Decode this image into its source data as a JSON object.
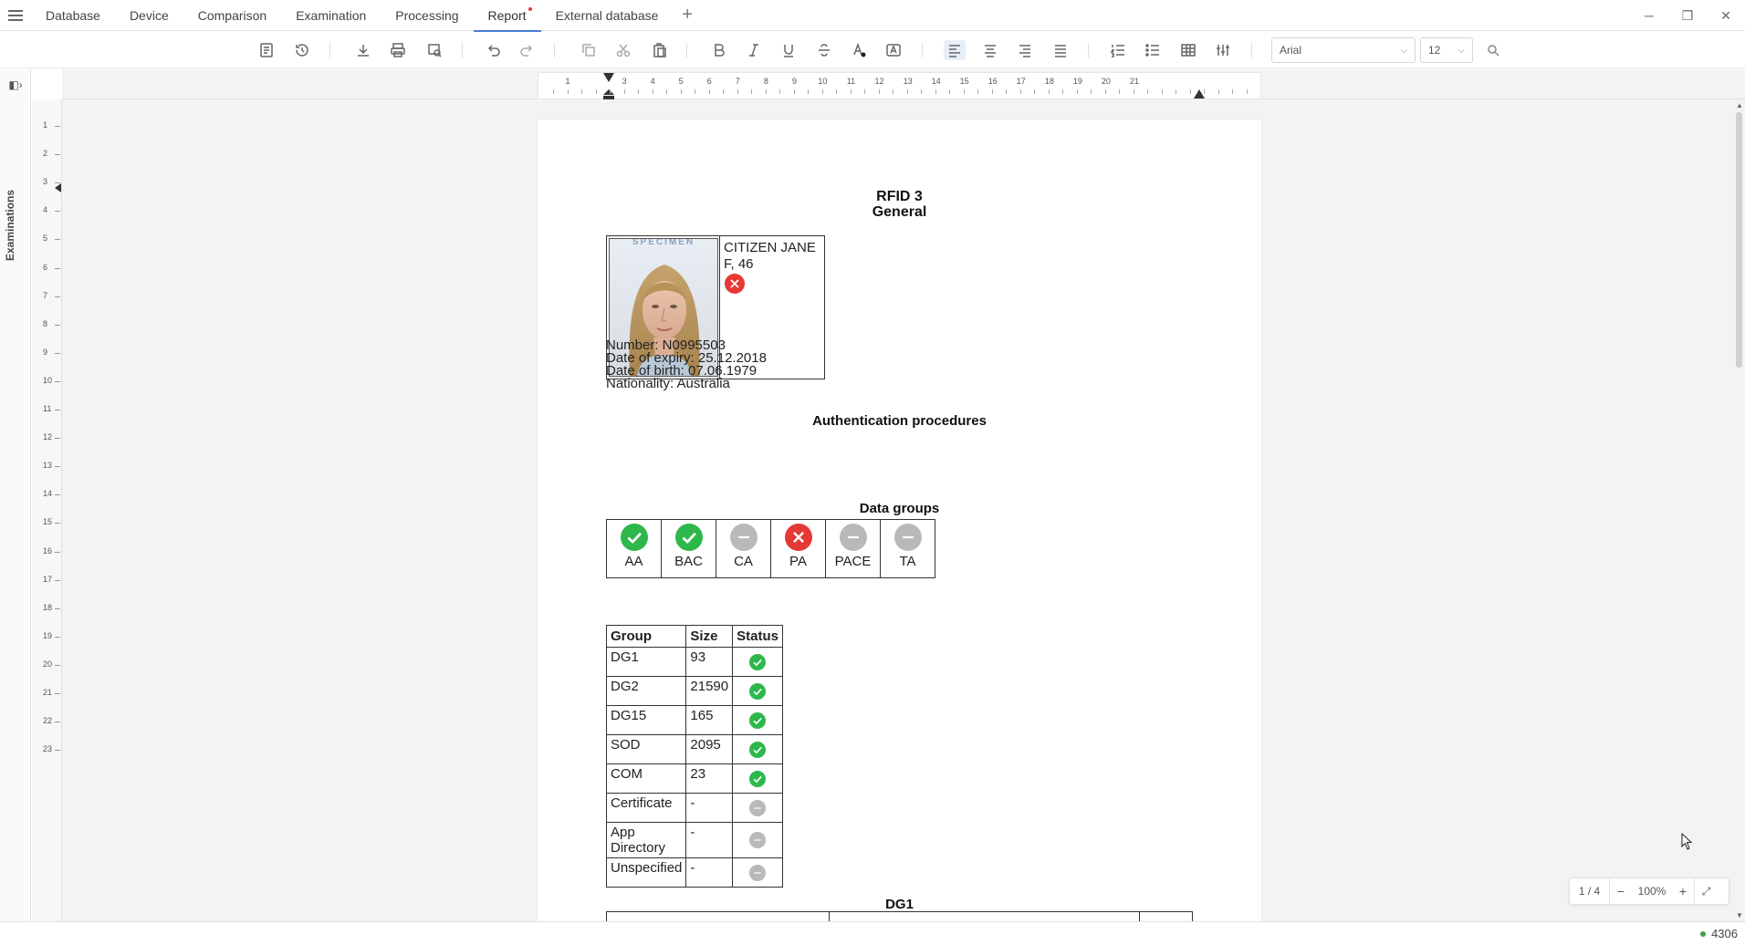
{
  "menu": {
    "tabs": [
      {
        "label": "Database"
      },
      {
        "label": "Device"
      },
      {
        "label": "Comparison"
      },
      {
        "label": "Examination"
      },
      {
        "label": "Processing"
      },
      {
        "label": "Report"
      },
      {
        "label": "External database"
      }
    ],
    "active_tab": "Report"
  },
  "toolbar": {
    "font_family": "Arial",
    "font_size": "12"
  },
  "sidebar": {
    "panel_label": "Examinations"
  },
  "ruler": {
    "h_numbers": [
      "1",
      "3",
      "4",
      "5",
      "6",
      "7",
      "8",
      "9",
      "10",
      "11",
      "12",
      "13",
      "14",
      "15",
      "16",
      "17",
      "18",
      "19",
      "20",
      "21"
    ],
    "v_numbers": [
      "1",
      "2",
      "3",
      "4",
      "5",
      "6",
      "7",
      "8",
      "9",
      "10",
      "11",
      "12",
      "13",
      "14",
      "15",
      "16",
      "17",
      "18",
      "19",
      "20",
      "21",
      "22",
      "23"
    ]
  },
  "report": {
    "title_line1": "RFID 3",
    "title_line2": "General",
    "holder": {
      "photo_watermark": "SPECIMEN",
      "name": "CITIZEN JANE",
      "sex_age": "F, 46",
      "status": "fail"
    },
    "info": [
      "Number: N0995503",
      "Date of expiry: 25.12.2018",
      "Date of birth: 07.06.1979",
      "Nationality: Australia"
    ],
    "auth_title": "Authentication procedures",
    "auth": [
      {
        "label": "AA",
        "status": "ok"
      },
      {
        "label": "BAC",
        "status": "ok"
      },
      {
        "label": "CA",
        "status": "none"
      },
      {
        "label": "PA",
        "status": "fail"
      },
      {
        "label": "PACE",
        "status": "none"
      },
      {
        "label": "TA",
        "status": "none"
      }
    ],
    "dg_title": "Data groups",
    "dg_headers": [
      "Group",
      "Size",
      "Status"
    ],
    "dg_rows": [
      {
        "group": "DG1",
        "size": "93",
        "status": "ok"
      },
      {
        "group": "DG2",
        "size": "21590",
        "status": "ok"
      },
      {
        "group": "DG15",
        "size": "165",
        "status": "ok"
      },
      {
        "group": "SOD",
        "size": "2095",
        "status": "ok"
      },
      {
        "group": "COM",
        "size": "23",
        "status": "ok"
      },
      {
        "group": "Certificate",
        "size": "-",
        "status": "none"
      },
      {
        "group": "App Directory",
        "size": "-",
        "status": "none"
      },
      {
        "group": "Unspecified",
        "size": "-",
        "status": "none"
      }
    ],
    "dg1_title": "DG1"
  },
  "zoom": {
    "page_indicator": "1 / 4",
    "minus": "−",
    "value": "100%",
    "plus": "+"
  },
  "status": {
    "count": "4306"
  },
  "colors": {
    "ok": "#2eb84b",
    "fail": "#e53935",
    "none": "#b9b9b9",
    "accent": "#4a7fd4"
  }
}
